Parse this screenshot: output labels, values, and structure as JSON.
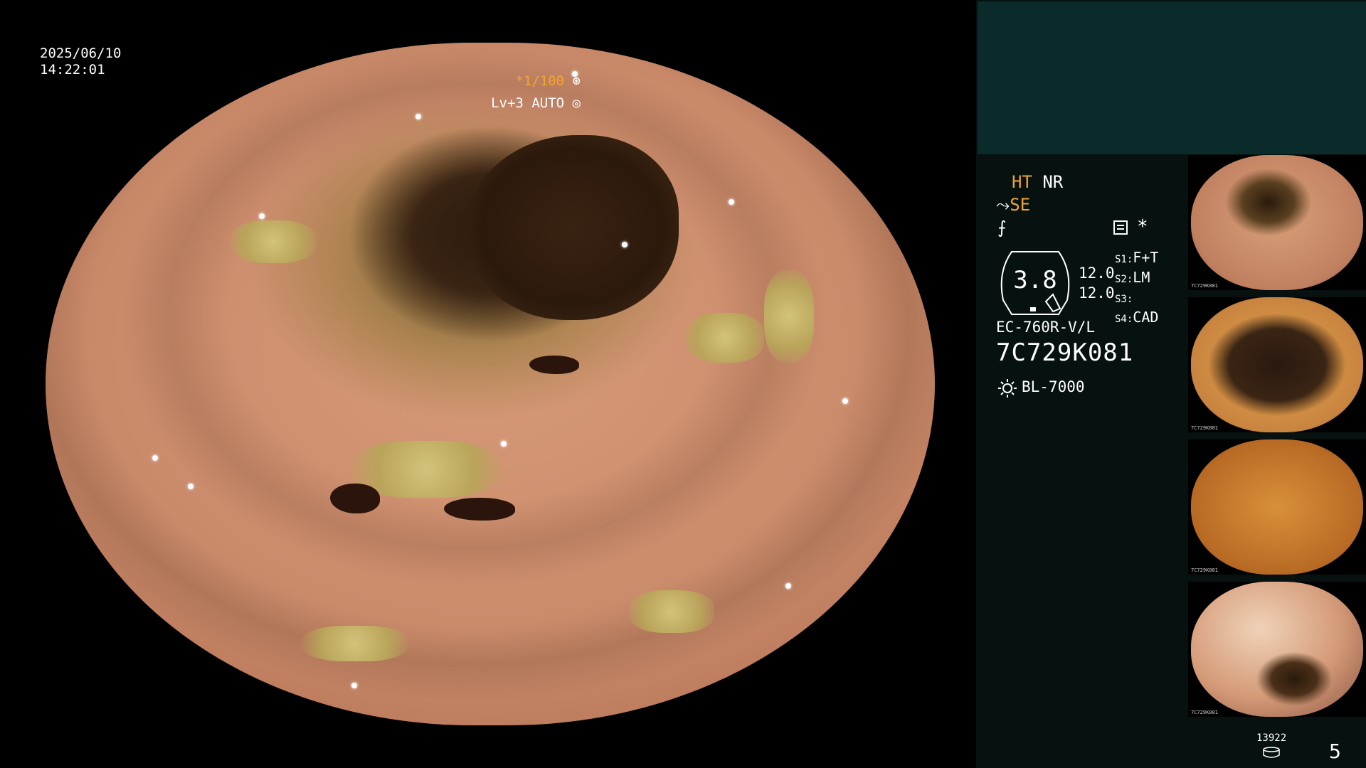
{
  "timestamp": {
    "date": "2025/06/10",
    "time": "14:22:01"
  },
  "shutter": {
    "speed": "*1/100",
    "level": "Lv+3",
    "mode": "AUTO"
  },
  "modes": {
    "ht": "HT",
    "nr": "NR",
    "se": "SE"
  },
  "gauge": {
    "value": "3.8",
    "right_values": [
      "12.0",
      "12.0"
    ]
  },
  "switches": [
    {
      "label": "S1:",
      "value": "F+T"
    },
    {
      "label": "S2:",
      "value": "LM"
    },
    {
      "label": "S3:",
      "value": ""
    },
    {
      "label": "S4:",
      "value": "CAD"
    }
  ],
  "scope": {
    "model": "EC-760R-V/L",
    "serial": "7C729K081",
    "light_source": "BL-7000"
  },
  "thumbnails": [
    {
      "id_text": "7C729K081",
      "type": "thumb-1"
    },
    {
      "id_text": "7C729K081",
      "type": "thumb-2"
    },
    {
      "id_text": "7C729K081",
      "type": "thumb-3"
    },
    {
      "id_text": "7C729K081",
      "type": "thumb-4"
    }
  ],
  "storage": {
    "count": "13922"
  },
  "page": {
    "number": "5"
  },
  "colors": {
    "accent": "#f0a533",
    "panel": "#061110",
    "panel_top": "#0b2b2b"
  }
}
